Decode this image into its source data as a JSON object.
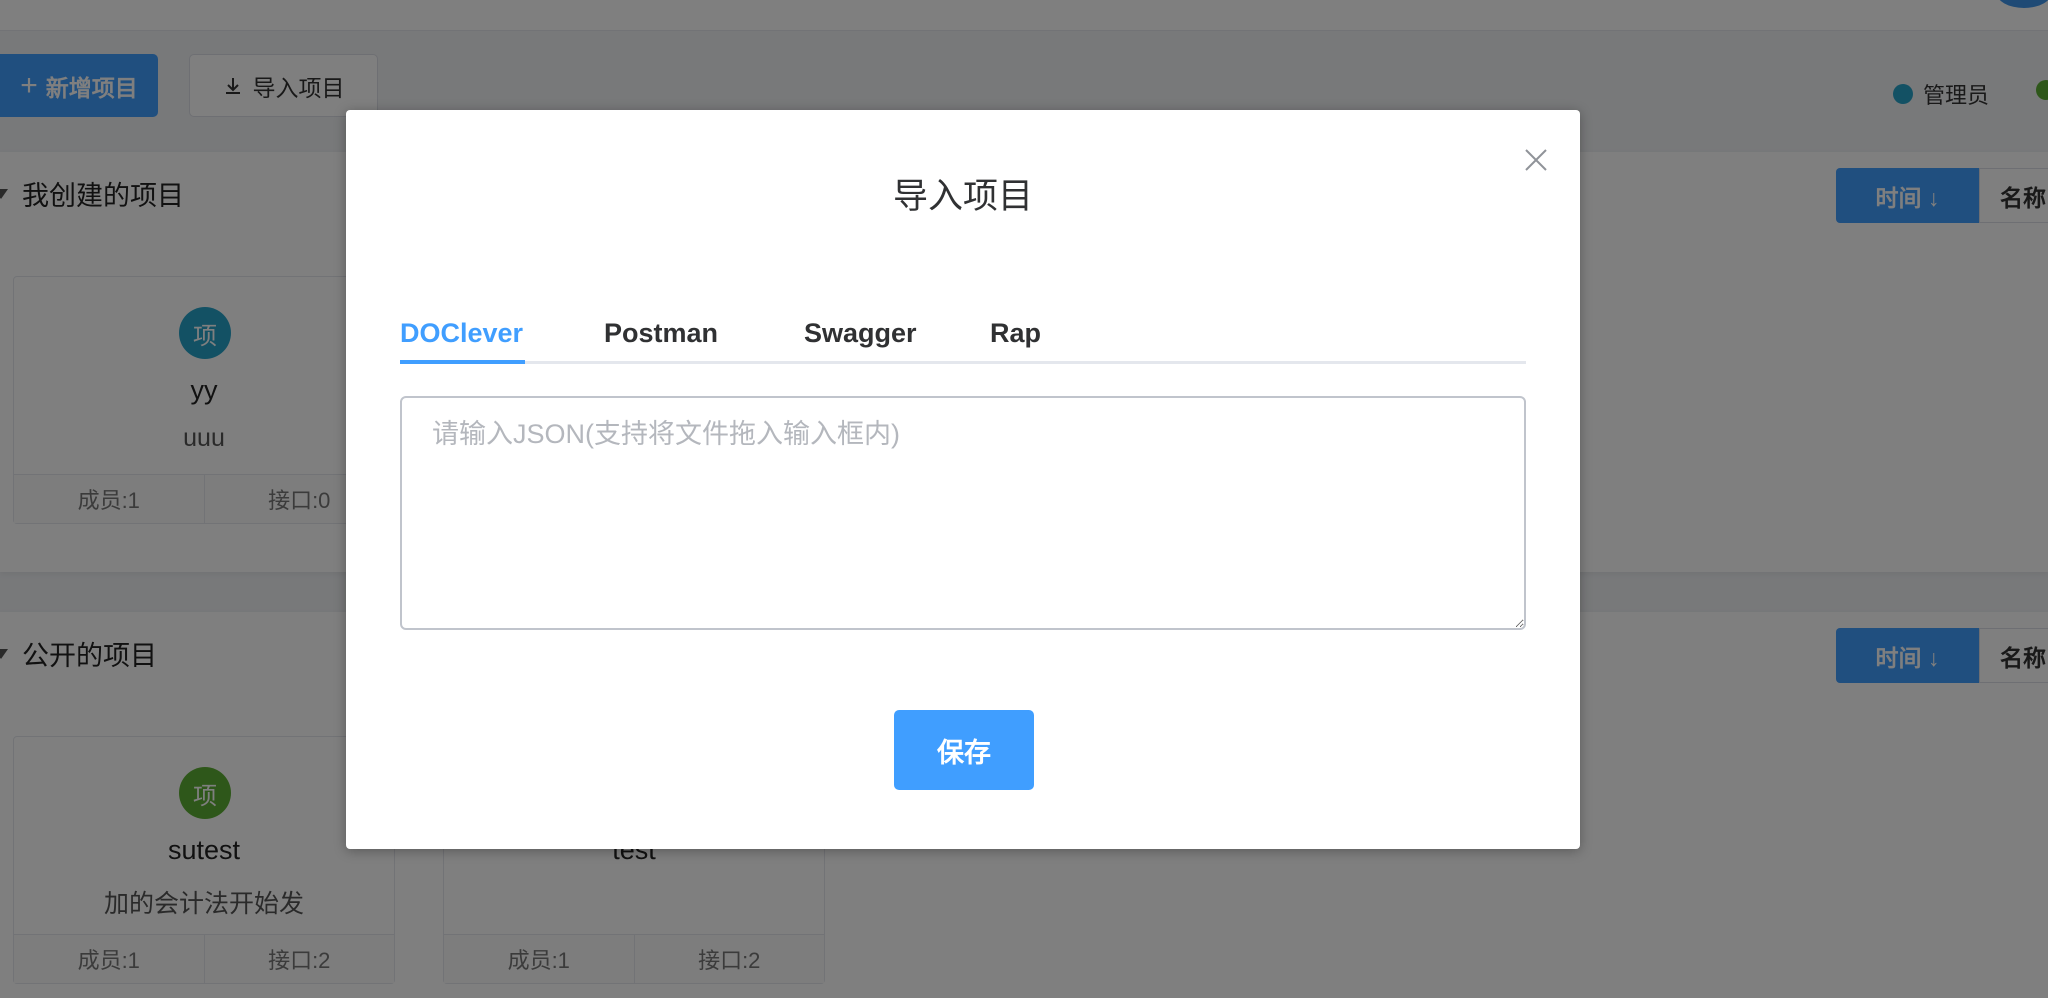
{
  "toolbar": {
    "new_project_label": "新增项目",
    "import_project_label": "导入项目"
  },
  "legend": {
    "admin_label": "管理员",
    "admin_color": "#26a2c9",
    "second_color": "#5daf34"
  },
  "sections": [
    {
      "title": "我创建的项目",
      "sort_time_label": "时间 ↓",
      "sort_name_label": "名称",
      "cards": [
        {
          "avatar_text": "项",
          "avatar_color": "#26a2c9",
          "name": "yy",
          "description": "uuu",
          "members": "成员:1",
          "interfaces": "接口:0"
        }
      ]
    },
    {
      "title": "公开的项目",
      "sort_time_label": "时间 ↓",
      "sort_name_label": "名称",
      "cards": [
        {
          "avatar_text": "项",
          "avatar_color": "#5daf34",
          "name": "sutest",
          "description": "加的会计法开始发",
          "members": "成员:1",
          "interfaces": "接口:2"
        },
        {
          "avatar_text": "",
          "avatar_color": "",
          "name": "test",
          "description": "",
          "members": "成员:1",
          "interfaces": "接口:2"
        }
      ]
    }
  ],
  "dialog": {
    "title": "导入项目",
    "tabs": [
      {
        "label": "DOClever",
        "active": true
      },
      {
        "label": "Postman",
        "active": false
      },
      {
        "label": "Swagger",
        "active": false
      },
      {
        "label": "Rap",
        "active": false
      }
    ],
    "json_placeholder": "请输入JSON(支持将文件拖入输入框内)",
    "json_value": "",
    "save_label": "保存"
  },
  "colors": {
    "primary": "#409eff",
    "overlay": "rgba(0,0,0,0.5)"
  }
}
